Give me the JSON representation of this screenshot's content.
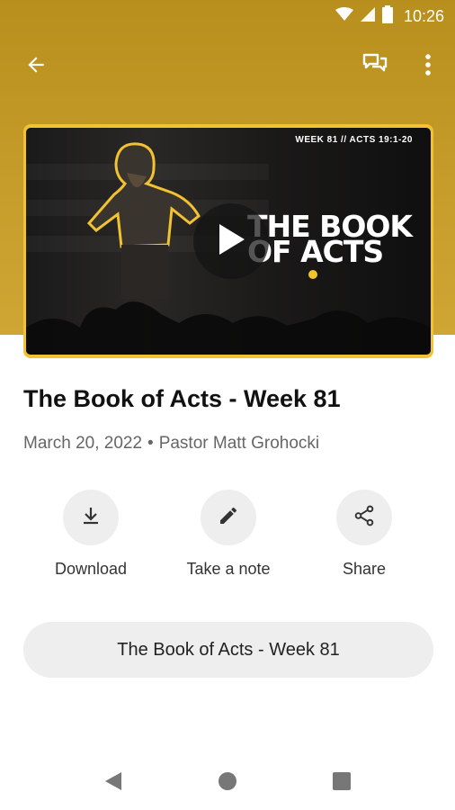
{
  "status_bar": {
    "time": "10:26",
    "icons": [
      "wifi-icon",
      "cell-signal-icon",
      "battery-icon"
    ]
  },
  "app_bar": {
    "back_icon": "arrow-back-icon",
    "actions": [
      "chat-icon",
      "more-vert-icon"
    ]
  },
  "video": {
    "week_tag": "WEEK 81 // ACTS 19:1-20",
    "graphic_title_line1": "THE BOOK",
    "graphic_title_line2": "OF ACTS",
    "play_icon": "play-icon"
  },
  "sermon": {
    "title": "The Book of Acts - Week 81",
    "date": "March 20, 2022",
    "separator": "•",
    "speaker": "Pastor Matt Grohocki"
  },
  "actions": [
    {
      "label": "Download",
      "icon": "download-icon"
    },
    {
      "label": "Take a note",
      "icon": "pencil-icon"
    },
    {
      "label": "Share",
      "icon": "share-icon"
    }
  ],
  "series_button": {
    "label": "The Book of Acts - Week 81"
  },
  "nav_bar": {
    "buttons": [
      "nav-back-icon",
      "nav-home-icon",
      "nav-recents-icon"
    ]
  },
  "colors": {
    "header_gold": "#c79d2c",
    "card_border": "#f2c230",
    "pill_bg": "#eeeeee"
  }
}
